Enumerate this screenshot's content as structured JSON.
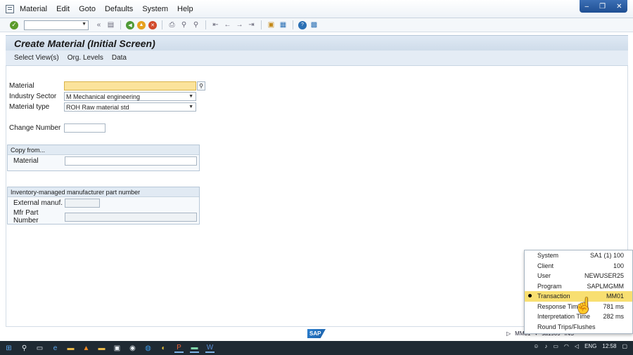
{
  "menu": {
    "items": [
      {
        "label": "Material"
      },
      {
        "label": "Edit"
      },
      {
        "label": "Goto"
      },
      {
        "label": "Defaults"
      },
      {
        "label": "System"
      },
      {
        "label": "Help"
      }
    ]
  },
  "toolbar": {
    "command_value": "",
    "icons": [
      "check-icon",
      "back-icon",
      "exit-icon",
      "cancel-icon",
      "print-icon",
      "find-icon",
      "first-page-icon",
      "prev-page-icon",
      "next-page-icon",
      "last-page-icon",
      "new-session-icon",
      "shortcut-icon",
      "help-icon",
      "layout-icon"
    ]
  },
  "title": "Create Material (Initial Screen)",
  "appbar": {
    "items": [
      "Select View(s)",
      "Org. Levels",
      "Data"
    ]
  },
  "form": {
    "material_label": "Material",
    "material_value": "",
    "industry_label": "Industry Sector",
    "industry_value": "M Mechanical engineering",
    "type_label": "Material type",
    "type_value": "ROH Raw material std",
    "change_label": "Change Number",
    "change_value": ""
  },
  "copy_from": {
    "title": "Copy from...",
    "material_label": "Material",
    "material_value": ""
  },
  "mpn": {
    "title": "Inventory-managed manufacturer part number",
    "ext_label": "External manuf.",
    "ext_value": "",
    "mfr_label": "Mfr Part Number",
    "mfr_value": ""
  },
  "status": {
    "logo": "SAP",
    "transaction": "MM01",
    "server": "sa1909",
    "mode": "INS"
  },
  "system_popup": {
    "rows": [
      {
        "key": "System",
        "value": "SA1 (1) 100"
      },
      {
        "key": "Client",
        "value": "100"
      },
      {
        "key": "User",
        "value": "NEWUSER25"
      },
      {
        "key": "Program",
        "value": "SAPLMGMM"
      },
      {
        "key": "Transaction",
        "value": "MM01"
      },
      {
        "key": "Response Time",
        "value": "781 ms"
      },
      {
        "key": "Interpretation Time",
        "value": "282 ms"
      },
      {
        "key": "Round Trips/Flushes",
        "value": ""
      }
    ]
  },
  "taskbar": {
    "lang": "ENG",
    "time": "12:58"
  },
  "colors": {
    "required_field": "#fbe39b",
    "selected_row": "#f8df71",
    "taskbar": "#1f2a33"
  }
}
